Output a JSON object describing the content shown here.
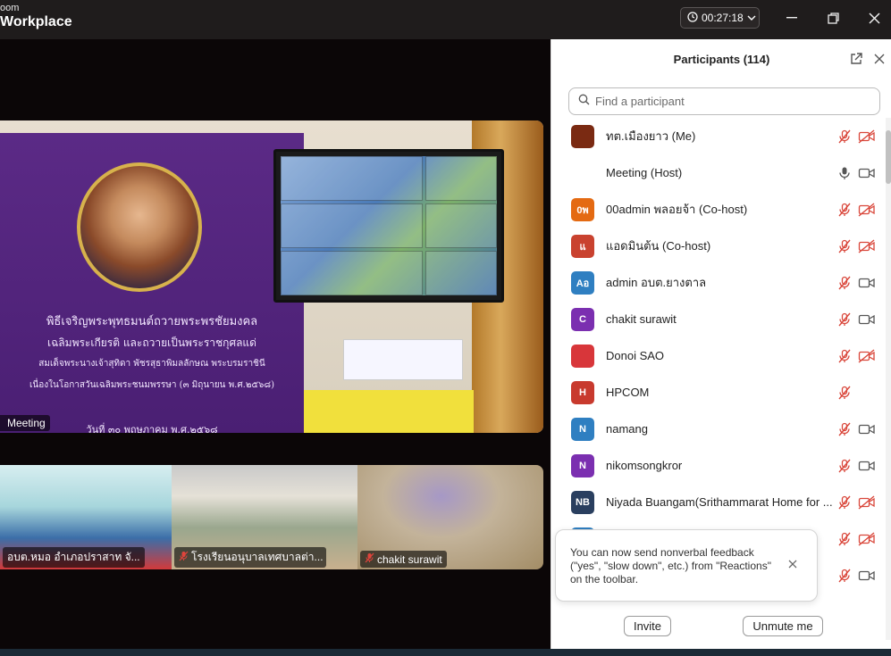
{
  "window": {
    "brand_line1": "oom",
    "brand_line2": "Workplace",
    "timer": "00:27:18"
  },
  "stage": {
    "main_name": "Meeting",
    "banner_lines": [
      "พิธีเจริญพระพุทธมนต์ถวายพระพรชัยมงคล",
      "เฉลิมพระเกียรติ และถวายเป็นพระราชกุศลแด่",
      "สมเด็จพระนางเจ้าสุทิดา พัชรสุธาพิมลลักษณ พระบรมราชินี",
      "เนื่องในโอกาสวันเฉลิมพระชนมพรรษา (๓ มิถุนายน พ.ศ.๒๕๖๘)"
    ],
    "banner_date": "วันที่ ๓๐ พฤษภาคม พ.ศ.๒๕๖๘",
    "thumbnails": [
      {
        "name": "อบต.หมอ อำเภอปราสาท จั..."
      },
      {
        "name": "โรงเรียนอนุบาลเทศบาลต่า..."
      },
      {
        "name": "chakit surawit"
      }
    ]
  },
  "panel": {
    "title": "Participants (114)",
    "search_placeholder": "Find a participant",
    "participants": [
      {
        "name": "ทต.เมืองยาว (Me)",
        "avatar_text": "",
        "avatar_color": "#7a2a12",
        "mic": "muted",
        "cam": "off"
      },
      {
        "name": "Meeting (Host)",
        "avatar_text": "",
        "avatar_color": "#ffffff",
        "mic": "on",
        "cam": "on"
      },
      {
        "name": "00admin พลอยจ้า (Co-host)",
        "avatar_text": "0พ",
        "avatar_color": "#e46a12",
        "mic": "muted",
        "cam": "off"
      },
      {
        "name": "แอดมินต้น (Co-host)",
        "avatar_text": "แ",
        "avatar_color": "#c9422f",
        "mic": "muted",
        "cam": "off"
      },
      {
        "name": "admin  อบต.ยางตาล",
        "avatar_text": "Aอ",
        "avatar_color": "#2f7fc1",
        "mic": "muted",
        "cam": "on"
      },
      {
        "name": "chakit surawit",
        "avatar_text": "C",
        "avatar_color": "#7b2fb0",
        "mic": "muted",
        "cam": "on"
      },
      {
        "name": "Donoi SAO",
        "avatar_text": "",
        "avatar_color": "#d8363a",
        "mic": "muted",
        "cam": "off"
      },
      {
        "name": "HPCOM",
        "avatar_text": "H",
        "avatar_color": "#c83a2e",
        "mic": "muted",
        "cam": "none"
      },
      {
        "name": "namang",
        "avatar_text": "N",
        "avatar_color": "#2f7fc1",
        "mic": "muted",
        "cam": "on"
      },
      {
        "name": "nikomsongkror",
        "avatar_text": "N",
        "avatar_color": "#7b2fb0",
        "mic": "muted",
        "cam": "on"
      },
      {
        "name": "Niyada Buangam(Srithammarat Home for ...",
        "avatar_text": "NB",
        "avatar_color": "#2a3f5f",
        "mic": "muted",
        "cam": "off"
      },
      {
        "name": "",
        "avatar_text": "",
        "avatar_color": "#2f7fc1",
        "mic": "muted",
        "cam": "off"
      },
      {
        "name": "",
        "avatar_text": "",
        "avatar_color": "#2f7fc1",
        "mic": "muted",
        "cam": "on"
      }
    ],
    "toast_text": "You can now send nonverbal feedback (\"yes\", \"slow down\", etc.) from \"Reactions\" on the toolbar.",
    "invite_label": "Invite",
    "unmute_label": "Unmute me"
  },
  "colors": {
    "muted_red": "#d9463a",
    "titlebar_bg": "#1f1c1c",
    "banner_purple": "#5b2a86"
  }
}
